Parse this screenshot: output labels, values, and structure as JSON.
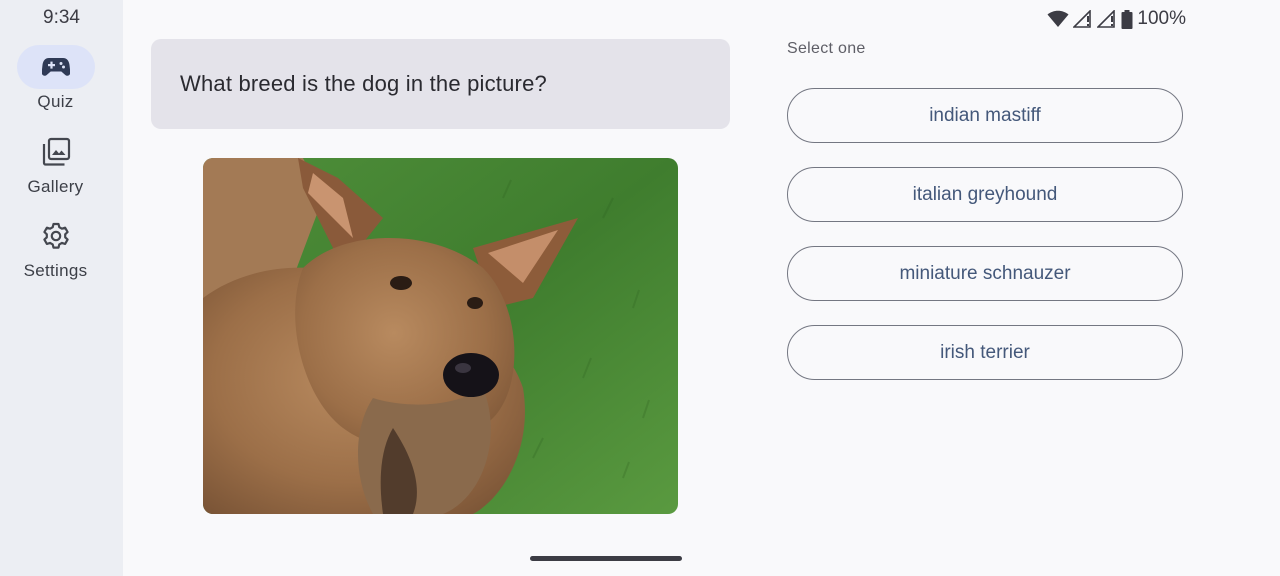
{
  "status_bar": {
    "time": "9:34",
    "battery": "100%"
  },
  "nav": {
    "items": [
      {
        "label": "Quiz",
        "icon": "gamepad-icon",
        "active": true
      },
      {
        "label": "Gallery",
        "icon": "gallery-icon",
        "active": false
      },
      {
        "label": "Settings",
        "icon": "gear-icon",
        "active": false
      }
    ]
  },
  "quiz": {
    "question": "What breed is the dog in the picture?",
    "select_label": "Select one",
    "options": [
      "indian mastiff",
      "italian greyhound",
      "miniature schnauzer",
      "irish terrier"
    ]
  },
  "colors": {
    "rail_bg": "#eceef3",
    "active_pill": "#dde3f8",
    "question_bg": "#e4e3ea",
    "answer_text": "#44587a",
    "answer_border": "#747782"
  }
}
